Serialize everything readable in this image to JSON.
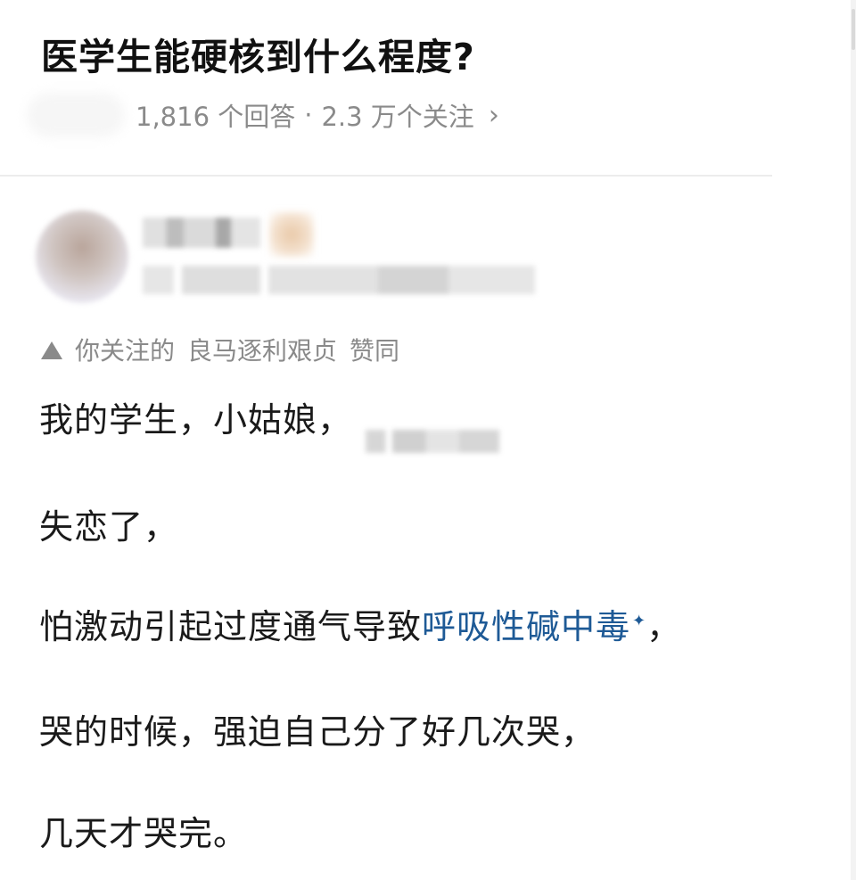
{
  "question": {
    "title": "医学生能硬核到什么程度?",
    "answers_count": "1,816 个回答",
    "separator": "·",
    "followers_count": "2.3 万个关注",
    "chevron": "›"
  },
  "answer": {
    "endorsement": {
      "icon": "triangle-up-icon",
      "prefix": "你关注的",
      "names": "良马逐利艰贞",
      "verb": "赞同"
    },
    "paragraphs": {
      "p1": "我的学生，小姑娘，",
      "p2": "失恋了，",
      "p3_before": "怕激动引起过度通气导致",
      "p3_link": "呼吸性碱中毒",
      "p3_sparkle": "✦",
      "p3_after": "，",
      "p4": "哭的时候，强迫自己分了好几次哭，",
      "p5": "几天才哭完。"
    }
  },
  "colors": {
    "link": "#1e5a96",
    "meta_text": "#8a8a8a",
    "title_text": "#111111"
  }
}
